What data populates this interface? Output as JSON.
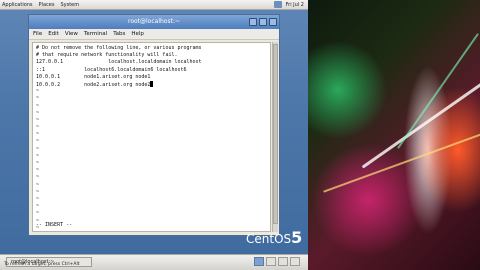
{
  "top_panel": {
    "menus": [
      "Applications",
      "Places",
      "System"
    ],
    "clock": "Fri Jul 2"
  },
  "window": {
    "title": "root@localhost:~",
    "menu": [
      "File",
      "Edit",
      "View",
      "Terminal",
      "Tabs",
      "Help"
    ]
  },
  "terminal": {
    "lines": [
      "# Do not remove the following line, or various programs",
      "# that require network functionality will fail.",
      "127.0.0.1               localhost.localdomain localhost",
      "::1             localhost6.localdomain6 localhost6",
      "10.0.0.1        node1.ariset.org node1",
      "10.0.0.2        node2.ariset.org node2"
    ],
    "tilde": "~",
    "mode": "-- INSERT --"
  },
  "taskbar": {
    "task_label": "root@localhost:~",
    "status": "To refresh a target, press Ctrl+Alt"
  },
  "logo": {
    "brand": "CentOS",
    "version": "5"
  }
}
